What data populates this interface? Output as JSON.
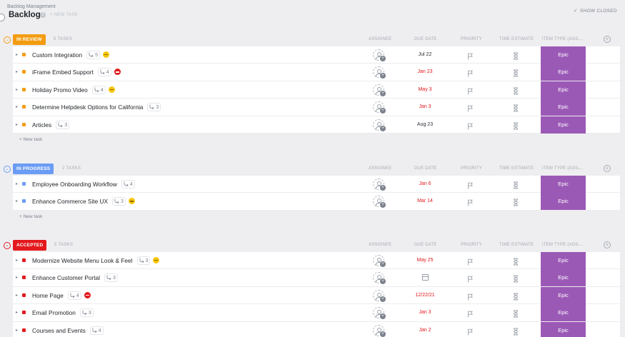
{
  "header": {
    "breadcrumb": "Backlog Management",
    "title": "Backlog",
    "new_task_label": "+ NEW TASK",
    "show_closed_label": "SHOW CLOSED"
  },
  "columns": {
    "assignee": "ASSIGNEE",
    "due_date": "DUE DATE",
    "priority": "PRIORITY",
    "time_estimate": "TIME ESTIMATE",
    "item_type": "ITEM TYPE (AGIL..."
  },
  "colors": {
    "in_review": "#f39c12",
    "in_progress": "#6b9cf4",
    "accepted": "#e3191d",
    "epic": "#9b59b6"
  },
  "groups": [
    {
      "status": "IN REVIEW",
      "count": "5 TASKS",
      "new_task": "+ New task",
      "rows": [
        {
          "name": "Custom Integration",
          "subtasks": "5",
          "flag": "yellow",
          "due": "Jul 22",
          "due_color": "dark",
          "type": "Epic"
        },
        {
          "name": "iFrame Embed Support",
          "subtasks": "4",
          "flag": "red",
          "due": "Jan 23",
          "due_color": "red",
          "type": "Epic"
        },
        {
          "name": "Holiday Promo Video",
          "subtasks": "4",
          "flag": "yellow",
          "due": "May 3",
          "due_color": "red",
          "type": "Epic"
        },
        {
          "name": "Determine Helpdesk Options for California",
          "subtasks": "3",
          "flag": "",
          "due": "Jan 3",
          "due_color": "red",
          "type": "Epic"
        },
        {
          "name": "Articles",
          "subtasks": "3",
          "flag": "",
          "due": "Aug 23",
          "due_color": "dark",
          "type": "Epic"
        }
      ]
    },
    {
      "status": "IN PROGRESS",
      "count": "2 TASKS",
      "new_task": "+ New task",
      "rows": [
        {
          "name": "Employee Onboarding Workflow",
          "subtasks": "4",
          "flag": "",
          "due": "Jan 6",
          "due_color": "red",
          "type": "Epic"
        },
        {
          "name": "Enhance Commerce Site UX",
          "subtasks": "3",
          "flag": "yellow",
          "due": "Mar 14",
          "due_color": "red",
          "type": "Epic"
        }
      ]
    },
    {
      "status": "ACCEPTED",
      "count": "5 TASKS",
      "rows": [
        {
          "name": "Modernize Website Menu Look & Feel",
          "subtasks": "3",
          "flag": "yellow",
          "due": "May 25",
          "due_color": "red",
          "type": "Epic"
        },
        {
          "name": "Enhance Customer Portal",
          "subtasks": "3",
          "flag": "",
          "due": "",
          "due_color": "",
          "type": "Epic"
        },
        {
          "name": "Home Page",
          "subtasks": "4",
          "flag": "red",
          "due": "12/22/21",
          "due_color": "red",
          "type": "Epic"
        },
        {
          "name": "Email Promotion",
          "subtasks": "3",
          "flag": "",
          "due": "Jan 3",
          "due_color": "red",
          "type": "Epic"
        },
        {
          "name": "Courses and Events",
          "subtasks": "4",
          "flag": "",
          "due": "Jan 2",
          "due_color": "red",
          "type": "Epic"
        }
      ]
    }
  ]
}
